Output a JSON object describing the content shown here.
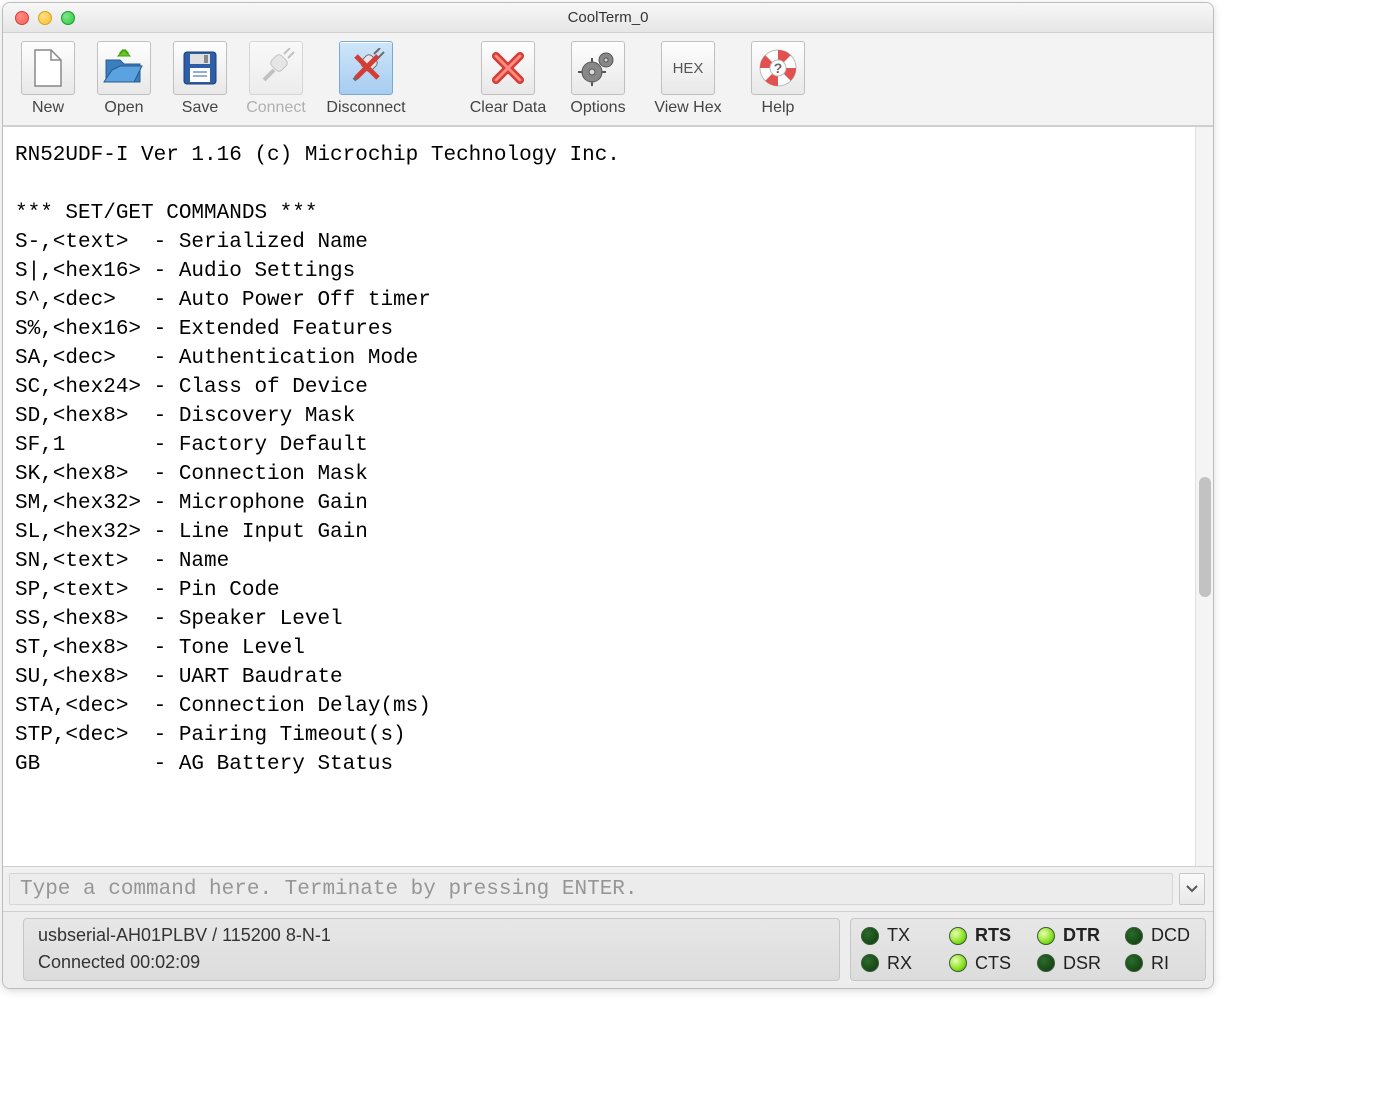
{
  "window": {
    "title": "CoolTerm_0"
  },
  "toolbar": {
    "new": "New",
    "open": "Open",
    "save": "Save",
    "connect": "Connect",
    "disconnect": "Disconnect",
    "clear": "Clear Data",
    "options": "Options",
    "viewhex": "View Hex",
    "help": "Help",
    "hex_text": "HEX"
  },
  "terminal": {
    "lines": [
      "RN52UDF-I Ver 1.16 (c) Microchip Technology Inc.",
      "",
      "*** SET/GET COMMANDS ***",
      "S-,<text>  - Serialized Name",
      "S|,<hex16> - Audio Settings",
      "S^,<dec>   - Auto Power Off timer",
      "S%,<hex16> - Extended Features",
      "SA,<dec>   - Authentication Mode",
      "SC,<hex24> - Class of Device",
      "SD,<hex8>  - Discovery Mask",
      "SF,1       - Factory Default",
      "SK,<hex8>  - Connection Mask",
      "SM,<hex32> - Microphone Gain",
      "SL,<hex32> - Line Input Gain",
      "SN,<text>  - Name",
      "SP,<text>  - Pin Code",
      "SS,<hex8>  - Speaker Level",
      "ST,<hex8>  - Tone Level",
      "SU,<hex8>  - UART Baudrate",
      "STA,<dec>  - Connection Delay(ms)",
      "STP,<dec>  - Pairing Timeout(s)",
      "GB         - AG Battery Status"
    ]
  },
  "command_input": {
    "placeholder": "Type a command here. Terminate by pressing ENTER."
  },
  "status": {
    "port_line": "usbserial-AH01PLBV / 115200 8-N-1",
    "conn_line": "Connected 00:02:09",
    "leds": {
      "tx": {
        "label": "TX",
        "on": false,
        "bold": false
      },
      "rx": {
        "label": "RX",
        "on": false,
        "bold": false
      },
      "rts": {
        "label": "RTS",
        "on": true,
        "bold": true
      },
      "cts": {
        "label": "CTS",
        "on": true,
        "bold": false
      },
      "dtr": {
        "label": "DTR",
        "on": true,
        "bold": true
      },
      "dsr": {
        "label": "DSR",
        "on": false,
        "bold": false
      },
      "dcd": {
        "label": "DCD",
        "on": false,
        "bold": false
      },
      "ri": {
        "label": "RI",
        "on": false,
        "bold": false
      }
    }
  }
}
